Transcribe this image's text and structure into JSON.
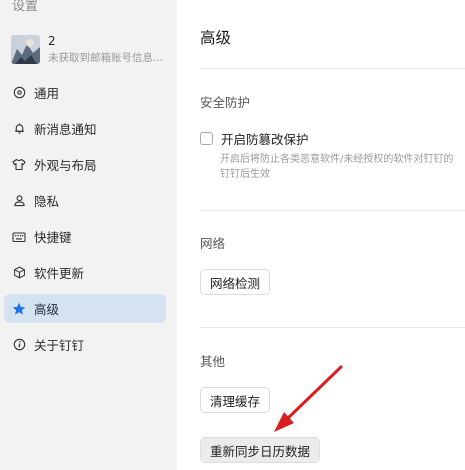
{
  "sidebar": {
    "title": "设置",
    "profile": {
      "name": "2",
      "subtitle": "未获取到邮箱账号信息..."
    },
    "items": [
      {
        "label": "通用",
        "icon": "settings-circle-icon"
      },
      {
        "label": "新消息通知",
        "icon": "bell-icon"
      },
      {
        "label": "外观与布局",
        "icon": "shirt-icon"
      },
      {
        "label": "隐私",
        "icon": "user-icon"
      },
      {
        "label": "快捷键",
        "icon": "keyboard-icon"
      },
      {
        "label": "软件更新",
        "icon": "cube-icon"
      },
      {
        "label": "高级",
        "icon": "star-icon",
        "active": true
      },
      {
        "label": "关于钉钉",
        "icon": "info-icon"
      }
    ]
  },
  "main": {
    "title": "高级",
    "security": {
      "title": "安全防护",
      "checkbox_label": "开启防篡改保护",
      "checked": false,
      "description": "开启后将防止各类恶意软件/未经授权的软件对钉钉的 钉钉后生效"
    },
    "network": {
      "title": "网络",
      "button": "网络检测"
    },
    "other": {
      "title": "其他",
      "clear_cache_button": "清理缓存",
      "resync_button": "重新同步日历数据"
    }
  },
  "colors": {
    "sidebar_bg": "#f2f2f3",
    "active_item_bg": "#d5e2ef",
    "active_icon": "#1a73e8",
    "annotation_arrow": "#d81e1e"
  }
}
